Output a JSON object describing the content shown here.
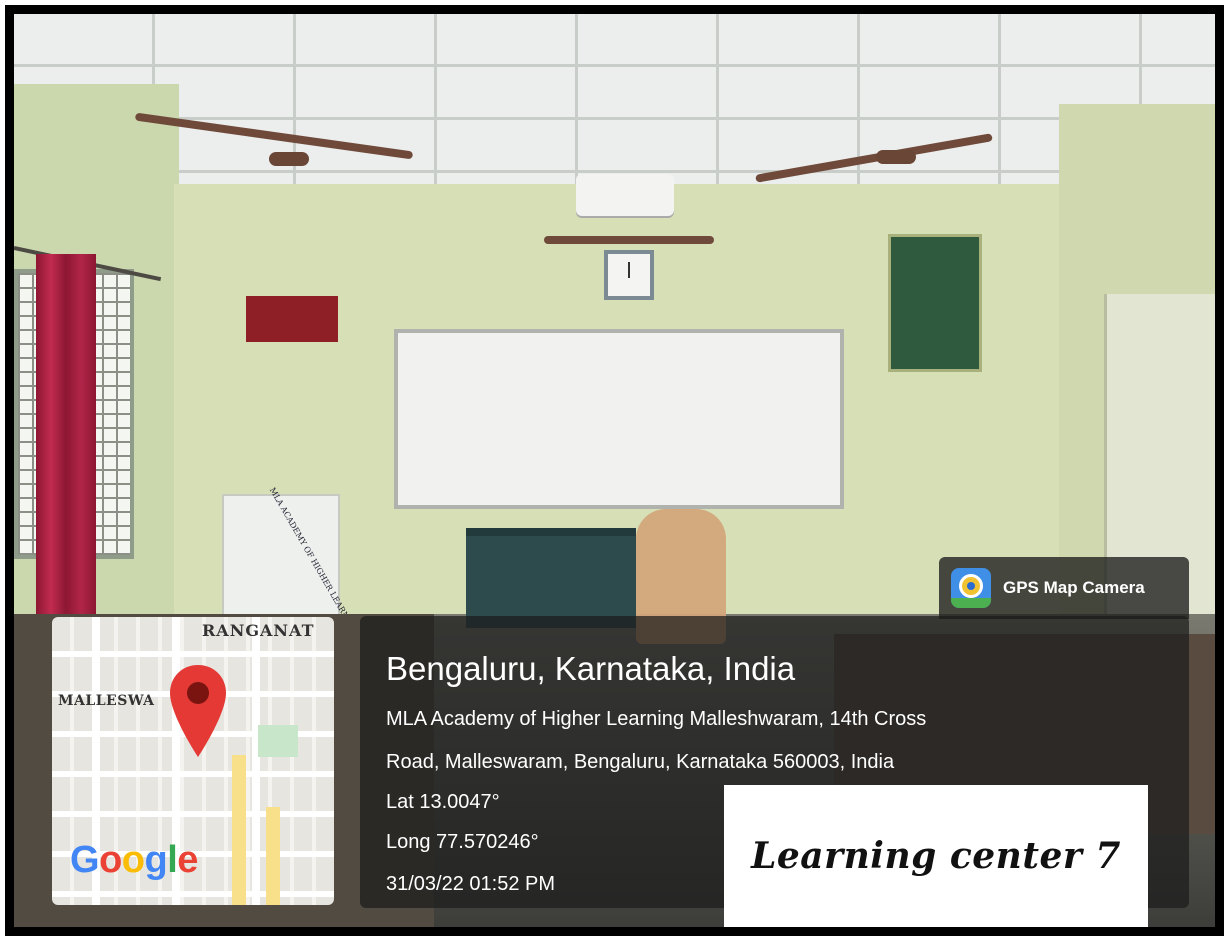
{
  "app": {
    "name": "GPS Map Camera",
    "icon": "gps-map-camera-icon"
  },
  "map": {
    "label_top": "RANGANAT",
    "label_left": "MALLESWA",
    "logo": "Google",
    "logo_letters": [
      "G",
      "o",
      "o",
      "g",
      "l",
      "e"
    ],
    "logo_colors": [
      "#4285F4",
      "#EA4335",
      "#FBBC05",
      "#4285F4",
      "#34A853",
      "#EA4335"
    ],
    "pin_color": "#E53935"
  },
  "location": {
    "title": "Bengaluru, Karnataka, India",
    "address_line1": "MLA Academy of Higher Learning Malleshwaram, 14th Cross",
    "address_line2": "Road, Malleswaram, Bengaluru, Karnataka 560003, India",
    "lat": "Lat 13.0047°",
    "long": "Long 77.570246°",
    "datetime": "31/03/22 01:52 PM"
  },
  "caption": "Learning center 7",
  "scene": {
    "podium_text": "MLA ACADEMY OF HIGHER LEARNING"
  }
}
